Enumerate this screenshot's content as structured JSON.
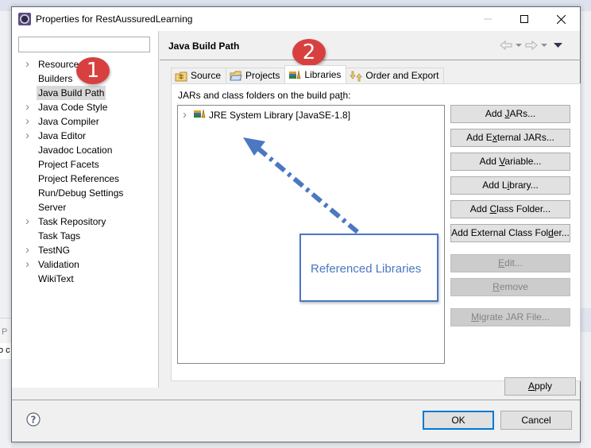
{
  "window": {
    "title": "Properties for RestAussuredLearning",
    "controls": {
      "minimize": "minimize",
      "maximize": "maximize",
      "close": "close"
    }
  },
  "sidebar": {
    "filter_placeholder": "",
    "filter_value": "",
    "items": [
      {
        "label": "Resource",
        "expandable": true,
        "selected": false
      },
      {
        "label": "Builders",
        "expandable": false,
        "selected": false
      },
      {
        "label": "Java Build Path",
        "expandable": false,
        "selected": true
      },
      {
        "label": "Java Code Style",
        "expandable": true,
        "selected": false
      },
      {
        "label": "Java Compiler",
        "expandable": true,
        "selected": false
      },
      {
        "label": "Java Editor",
        "expandable": true,
        "selected": false
      },
      {
        "label": "Javadoc Location",
        "expandable": false,
        "selected": false
      },
      {
        "label": "Project Facets",
        "expandable": false,
        "selected": false
      },
      {
        "label": "Project References",
        "expandable": false,
        "selected": false
      },
      {
        "label": "Run/Debug Settings",
        "expandable": false,
        "selected": false
      },
      {
        "label": "Server",
        "expandable": false,
        "selected": false
      },
      {
        "label": "Task Repository",
        "expandable": true,
        "selected": false
      },
      {
        "label": "Task Tags",
        "expandable": false,
        "selected": false
      },
      {
        "label": "TestNG",
        "expandable": true,
        "selected": false
      },
      {
        "label": "Validation",
        "expandable": true,
        "selected": false
      },
      {
        "label": "WikiText",
        "expandable": false,
        "selected": false
      }
    ]
  },
  "page": {
    "title": "Java Build Path",
    "tabs": [
      {
        "label": "Source",
        "icon": "source-folder-icon",
        "active": false
      },
      {
        "label": "Projects",
        "icon": "folder-icon",
        "active": false
      },
      {
        "label": "Libraries",
        "icon": "library-icon",
        "active": true
      },
      {
        "label": "Order and Export",
        "icon": "order-export-icon",
        "active": false
      }
    ],
    "description_prefix": "JARs and class folders on the build pa",
    "description_mnemonic": "t",
    "description_suffix": "h:",
    "libraries": [
      {
        "label": "JRE System Library [JavaSE-1.8]"
      }
    ],
    "buttons": [
      {
        "pre": "Add ",
        "mn": "J",
        "post": "ARs...",
        "enabled": true
      },
      {
        "pre": "Add E",
        "mn": "x",
        "post": "ternal JARs...",
        "enabled": true
      },
      {
        "pre": "Add ",
        "mn": "V",
        "post": "ariable...",
        "enabled": true
      },
      {
        "pre": "Add L",
        "mn": "i",
        "post": "brary...",
        "enabled": true
      },
      {
        "pre": "Add ",
        "mn": "C",
        "post": "lass Folder...",
        "enabled": true
      },
      {
        "pre": "Add External Class Fol",
        "mn": "d",
        "post": "er...",
        "enabled": true
      },
      {
        "pre": "",
        "mn": "E",
        "post": "dit...",
        "enabled": false
      },
      {
        "pre": "",
        "mn": "R",
        "post": "emove",
        "enabled": false
      },
      {
        "pre": "",
        "mn": "M",
        "post": "igrate JAR File...",
        "enabled": false
      }
    ],
    "apply": {
      "mn": "A",
      "post": "pply"
    }
  },
  "footer": {
    "ok": "OK",
    "cancel": "Cancel"
  },
  "annotations": {
    "badge1": "1",
    "badge2": "2",
    "callout": "Referenced Libraries",
    "color_badge": "#d84040",
    "color_callout": "#4a78c2"
  },
  "background": {
    "fragment1": "P",
    "fragment2": "o c"
  }
}
